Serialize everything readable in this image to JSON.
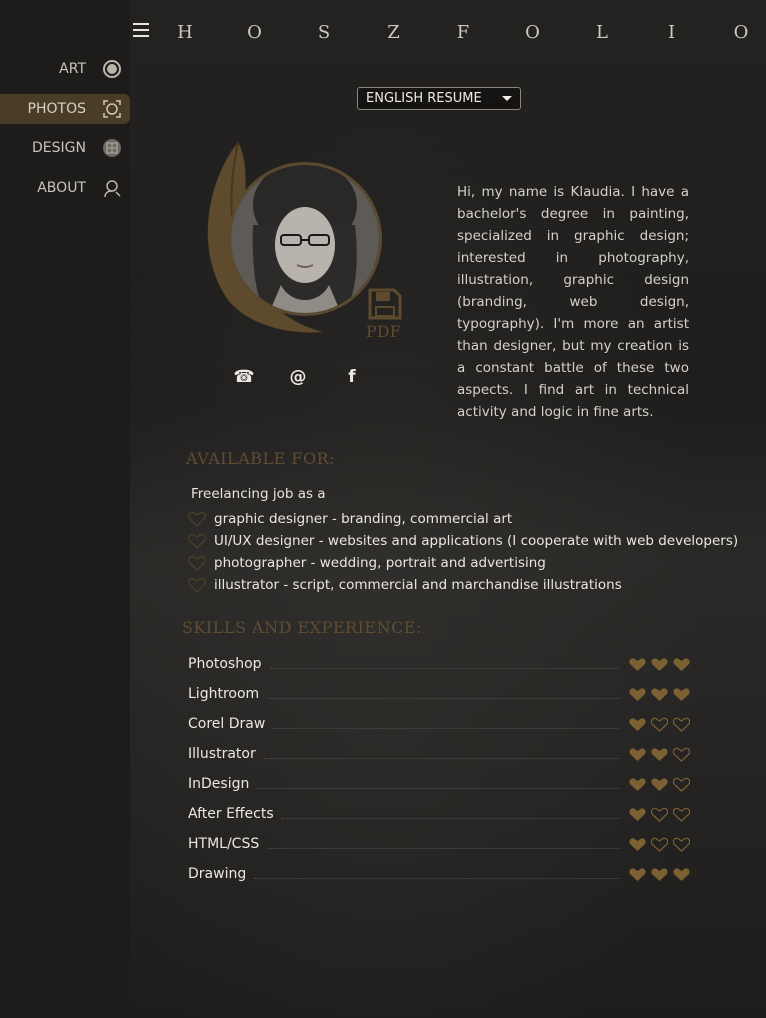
{
  "brand": {
    "letters": [
      "H",
      "O",
      "S",
      "Z",
      "F",
      "O",
      "L",
      "I",
      "O"
    ]
  },
  "nav": [
    {
      "label": "ART",
      "icon": "circle-target-icon",
      "active": false
    },
    {
      "label": "PHOTOS",
      "icon": "camera-frame-icon",
      "active": true
    },
    {
      "label": "DESIGN",
      "icon": "design-grid-icon",
      "active": false
    },
    {
      "label": "ABOUT",
      "icon": "person-search-icon",
      "active": false
    }
  ],
  "language_select": {
    "value": "ENGLISH RESUME"
  },
  "pdf_label": "PDF",
  "contact": {
    "phone": "☎",
    "email": "@",
    "facebook": "f"
  },
  "bio": "Hi, my name is Klaudia. I have a bachelor's degree in painting, specialized in graphic design; interested in photography, illustration, graphic design (branding, web design, typography). I'm more an artist than designer, but my creation is a constant battle of these two aspects. I find art in technical activity and logic in fine arts.",
  "available": {
    "title": "AVAILABLE FOR:",
    "intro": "Freelancing  job as a",
    "items": [
      "graphic designer -  branding, commercial art",
      "UI/UX designer - websites and applications (I cooperate with web developers)",
      "photographer - wedding, portrait and advertising",
      "illustrator - script, commercial and marchandise illustrations"
    ]
  },
  "skills": {
    "title": "SKILLS AND EXPERIENCE:",
    "max_rating": 3,
    "items": [
      {
        "name": "Photoshop",
        "rating": 3
      },
      {
        "name": "Lightroom",
        "rating": 3
      },
      {
        "name": "Corel Draw",
        "rating": 1
      },
      {
        "name": "Illustrator",
        "rating": 2
      },
      {
        "name": "InDesign",
        "rating": 2
      },
      {
        "name": "After Effects",
        "rating": 1
      },
      {
        "name": "HTML/CSS",
        "rating": 1
      },
      {
        "name": "Drawing",
        "rating": 3
      }
    ]
  },
  "colors": {
    "accent": "#7a6035",
    "accent_dark": "#4a3d28",
    "heart_fill": "#7b6033"
  }
}
